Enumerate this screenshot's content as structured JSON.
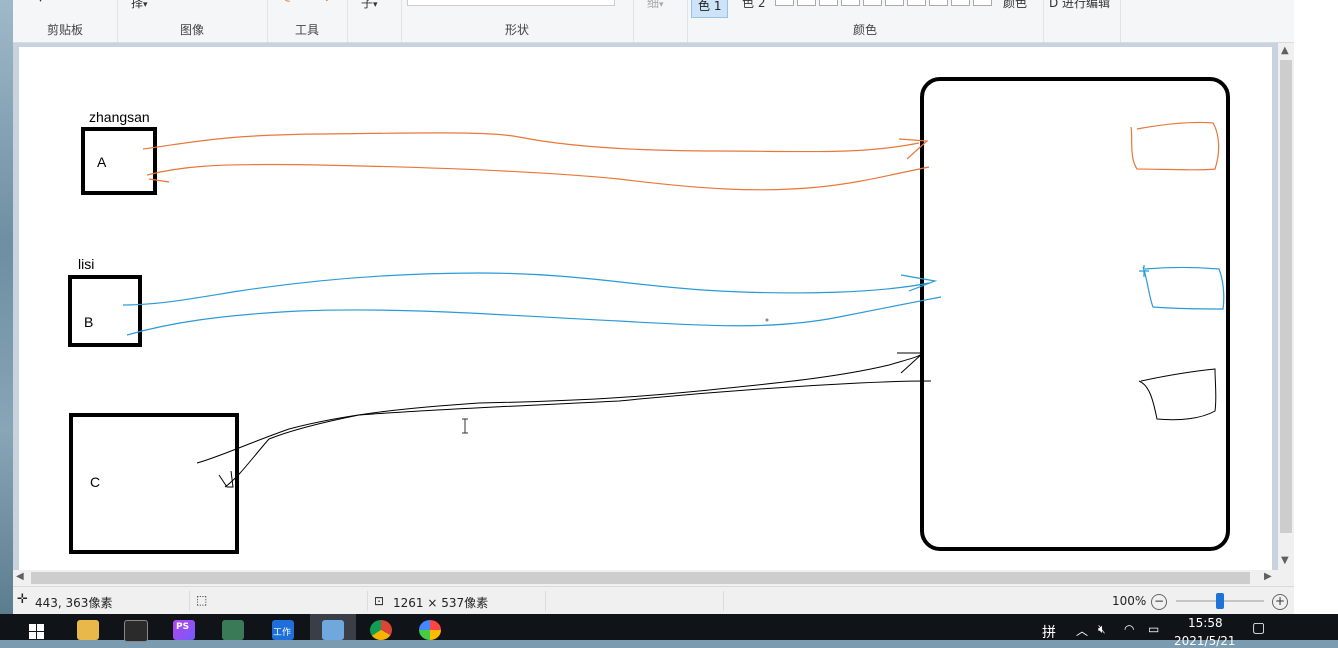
{
  "ribbon": {
    "groups": {
      "clipboard": "剪贴板",
      "image": "图像",
      "tools": "工具",
      "shapes": "形状",
      "colors": "颜色"
    },
    "partial_labels": {
      "select": "择",
      "brush": "子",
      "size": "细",
      "color1": "色 1",
      "color2": "色 2",
      "edit_colors": "颜色",
      "paint3d": "D 进行编辑"
    }
  },
  "canvas": {
    "labels": {
      "zhangsan": "zhangsan",
      "box_a": "A",
      "lisi": "lisi",
      "box_b": "B",
      "box_c": "C"
    },
    "stroke_colors": {
      "orange": "#e8773a",
      "blue": "#2a9ad6",
      "black": "#000000"
    }
  },
  "status": {
    "cursor_pos": "443, 363像素",
    "image_size": "1261 × 537像素",
    "zoom": "100%",
    "zoom_level": 0.5
  },
  "taskbar": {
    "ime": "拼",
    "time": "15:58",
    "date": "2021/5/21",
    "apps": [
      "start-icon",
      "file-explorer-icon",
      "terminal-icon",
      "phpstorm-icon",
      "git-icon",
      "work-icon",
      "paint-icon",
      "chrome-icon",
      "browser-icon"
    ],
    "work_label": "工作",
    "ps_label": "PS"
  }
}
